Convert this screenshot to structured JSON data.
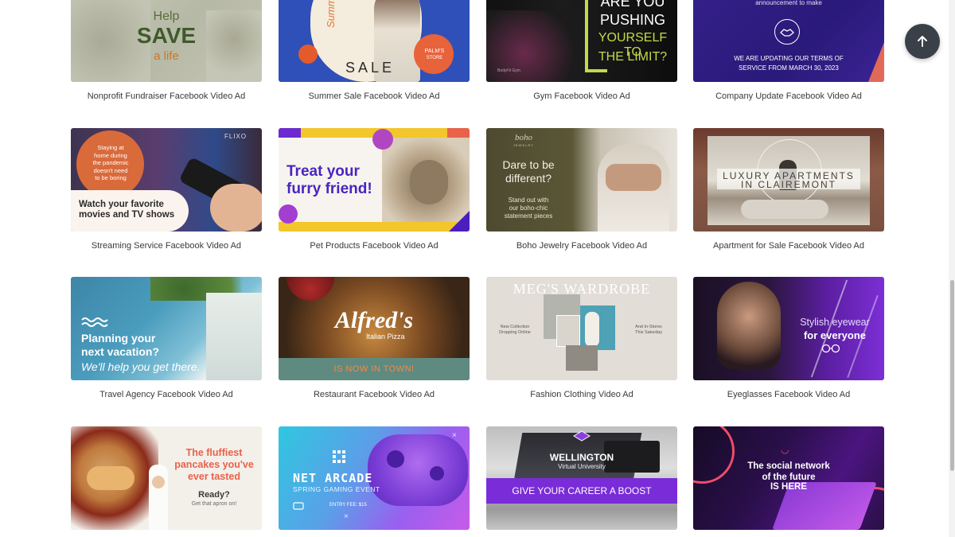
{
  "scroll_top": {
    "icon": "arrow-up-icon"
  },
  "cards": [
    {
      "caption": "Nonprofit Fundraiser Facebook Video Ad",
      "lines": [
        "Help",
        "SAVE",
        "a life"
      ]
    },
    {
      "caption": "Summer Sale Facebook Video Ad",
      "lines": [
        "Summer",
        "SALE",
        "PALM'S",
        "STORE"
      ]
    },
    {
      "caption": "Gym Facebook Video Ad",
      "lines": [
        "ARE YOU",
        "PUSHING",
        "YOURSELF TO",
        "THE LIMIT?",
        "BodyFit Gym"
      ]
    },
    {
      "caption": "Company Update Facebook Video Ad",
      "lines": [
        "announcement to make",
        "WE ARE UPDATING OUR TERMS OF",
        "SERVICE FROM MARCH 30, 2023"
      ]
    },
    {
      "caption": "Streaming Service Facebook Video Ad",
      "lines": [
        "Staying at",
        "home during",
        "the pandemic",
        "doesn't need",
        "to be boring",
        "Watch your favorite",
        "movies and TV shows",
        "FLIXO"
      ]
    },
    {
      "caption": "Pet Products Facebook Video Ad",
      "lines": [
        "Treat your",
        "furry friend!"
      ]
    },
    {
      "caption": "Boho Jewelry Facebook Video Ad",
      "lines": [
        "boho",
        "JEWELRY",
        "Dare to be",
        "different?",
        "Stand out with",
        "our boho-chic",
        "statement pieces"
      ]
    },
    {
      "caption": "Apartment for Sale Facebook Video Ad",
      "lines": [
        "LUXURY APARTMENTS",
        "IN CLAIREMONT"
      ]
    },
    {
      "caption": "Travel Agency Facebook Video Ad",
      "lines": [
        "Planning your",
        "next vacation?",
        "We'll help you get there."
      ]
    },
    {
      "caption": "Restaurant Facebook Video Ad",
      "lines": [
        "Alfred's",
        "Italian Pizza",
        "IS NOW IN TOWN!"
      ]
    },
    {
      "caption": "Fashion Clothing Video Ad",
      "lines": [
        "MEG'S WARDROBE",
        "New Collection",
        "Dropping Online",
        "And In-Stores",
        "This Saturday"
      ]
    },
    {
      "caption": "Eyeglasses Facebook Video Ad",
      "lines": [
        "Stylish eyewear",
        "for everyone"
      ]
    },
    {
      "caption": "",
      "lines": [
        "The fluffiest",
        "pancakes you've",
        "ever tasted",
        "Ready?",
        "Get that apron on!"
      ]
    },
    {
      "caption": "",
      "lines": [
        "NET ARCADE",
        "SPRING GAMING EVENT",
        "ENTRY FEE: $15"
      ]
    },
    {
      "caption": "",
      "lines": [
        "WELLINGTON",
        "Virtual University",
        "GIVE YOUR CAREER A BOOST"
      ]
    },
    {
      "caption": "",
      "lines": [
        "The social network",
        "of the future",
        "IS HERE"
      ]
    }
  ]
}
